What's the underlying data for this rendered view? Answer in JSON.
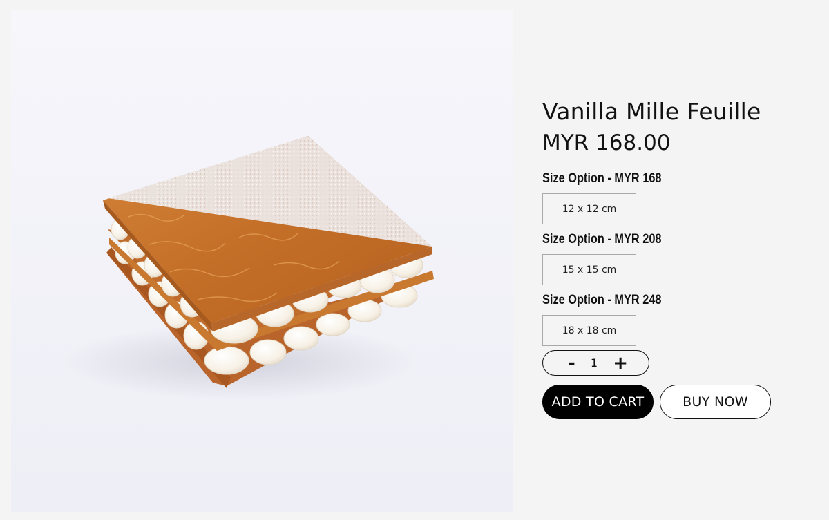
{
  "product": {
    "title": "Vanilla Mille Feuille",
    "price": "MYR 168.00",
    "image_alt": "Vanilla Mille Feuille pastry"
  },
  "size_options": [
    {
      "label": "Size Option - MYR 168",
      "value": "12 x 12 cm"
    },
    {
      "label": "Size Option - MYR 208",
      "value": "15 x 15 cm"
    },
    {
      "label": "Size Option - MYR 248",
      "value": "18 x 18 cm"
    }
  ],
  "quantity": {
    "minus": "-",
    "value": "1",
    "plus": "+"
  },
  "actions": {
    "add_to_cart": "ADD TO CART",
    "buy_now": "BUY NOW"
  },
  "colors": {
    "page_bg": "#f4f4f4",
    "primary": "#000000",
    "pastry": "#c8782f",
    "cream": "#fbf6ee"
  }
}
